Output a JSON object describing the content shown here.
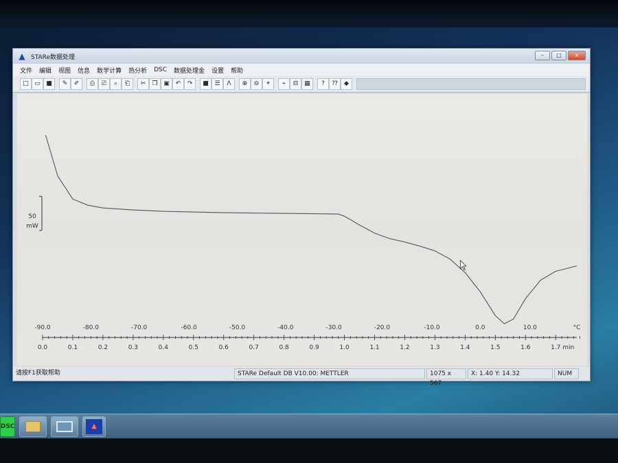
{
  "window": {
    "title": "STARe数据处理",
    "controls": {
      "minimize": "–",
      "maximize": "□",
      "close": "×"
    }
  },
  "menu": [
    "文件",
    "编辑",
    "视图",
    "信息",
    "数学计算",
    "热分析",
    "DSC",
    "数据处理金",
    "设置",
    "帮助"
  ],
  "toolbar": {
    "groups": [
      [
        {
          "icon": "new-file-icon",
          "glyph": "□"
        },
        {
          "icon": "open-folder-icon",
          "glyph": "▭"
        },
        {
          "icon": "save-icon",
          "glyph": "■"
        }
      ],
      [
        {
          "icon": "load-curve-icon",
          "glyph": "✎"
        },
        {
          "icon": "export-icon",
          "glyph": "✐"
        }
      ],
      [
        {
          "icon": "print-icon",
          "glyph": "⎙"
        },
        {
          "icon": "print-setup-icon",
          "glyph": "⎚"
        },
        {
          "icon": "preview-icon",
          "glyph": "⌕"
        },
        {
          "icon": "print-preview-icon",
          "glyph": "⎗"
        }
      ],
      [
        {
          "icon": "cut-icon",
          "glyph": "✂"
        },
        {
          "icon": "copy-icon",
          "glyph": "❐"
        },
        {
          "icon": "paste-icon",
          "glyph": "▣"
        },
        {
          "icon": "undo-icon",
          "glyph": "↶"
        },
        {
          "icon": "redo-icon",
          "glyph": "↷"
        }
      ],
      [
        {
          "icon": "stop-icon",
          "glyph": "■"
        },
        {
          "icon": "list-icon",
          "glyph": "☰"
        },
        {
          "icon": "peak-icon",
          "glyph": "Λ"
        }
      ],
      [
        {
          "icon": "zoom-in-icon",
          "glyph": "⊕"
        },
        {
          "icon": "zoom-out-icon",
          "glyph": "⊖"
        },
        {
          "icon": "zoom-fit-icon",
          "glyph": "⌖"
        }
      ],
      [
        {
          "icon": "curve-marker-icon",
          "glyph": "⌁"
        },
        {
          "icon": "split-view-icon",
          "glyph": "⊟"
        },
        {
          "icon": "table-icon",
          "glyph": "▦"
        }
      ],
      [
        {
          "icon": "help-icon",
          "glyph": "?"
        },
        {
          "icon": "context-help-icon",
          "glyph": "⁇"
        },
        {
          "icon": "book-icon",
          "glyph": "◆"
        }
      ]
    ]
  },
  "chart_data": {
    "type": "line",
    "title": "",
    "scale_bar": {
      "value": "50",
      "unit": "mW"
    },
    "top_axis": {
      "unit": "°C",
      "ticks": [
        "-90.0",
        "-80.0",
        "-70.0",
        "-60.0",
        "-50.0",
        "-40.0",
        "-30.0",
        "-20.0",
        "-10.0",
        "0.0",
        "10.0"
      ],
      "tick_time_min": [
        0.0,
        0.16,
        0.32,
        0.485,
        0.645,
        0.805,
        0.965,
        1.125,
        1.29,
        1.45,
        1.615
      ],
      "unit_time_min": 1.77
    },
    "bottom_axis": {
      "unit": "min",
      "ticks": [
        "0.0",
        "0.1",
        "0.2",
        "0.3",
        "0.4",
        "0.5",
        "0.6",
        "0.7",
        "0.8",
        "0.9",
        "1.0",
        "1.1",
        "1.2",
        "1.3",
        "1.4",
        "1.5",
        "1.6",
        "1.7"
      ],
      "range": [
        0.0,
        1.77
      ]
    },
    "y_range_mW": [
      -180,
      120
    ],
    "series": [
      {
        "x": [
          0.01,
          0.05,
          0.1,
          0.15,
          0.2,
          0.3,
          0.4,
          0.5,
          0.6,
          0.7,
          0.8,
          0.9,
          0.98,
          1.0,
          1.05,
          1.1,
          1.15,
          1.2,
          1.25,
          1.3,
          1.35,
          1.4,
          1.45,
          1.5,
          1.53,
          1.56,
          1.6,
          1.65,
          1.7,
          1.77
        ],
        "y": [
          100,
          40,
          6,
          -3,
          -7,
          -10,
          -12,
          -13,
          -14,
          -14.5,
          -15,
          -15.5,
          -16,
          -19,
          -32,
          -44,
          -52,
          -57,
          -63,
          -70,
          -82,
          -102,
          -130,
          -165,
          -177,
          -170,
          -140,
          -113,
          -100,
          -92
        ]
      }
    ]
  },
  "status": {
    "hint": "请按F1获取帮助",
    "db": "STARe Default DB V10.00: METTLER",
    "size": "1075 x 567",
    "coords": "X: 1.40 Y: 14.32",
    "num": "NUM"
  },
  "taskbar": {
    "dsc_label": "DSC",
    "stare_label": "STARe"
  }
}
